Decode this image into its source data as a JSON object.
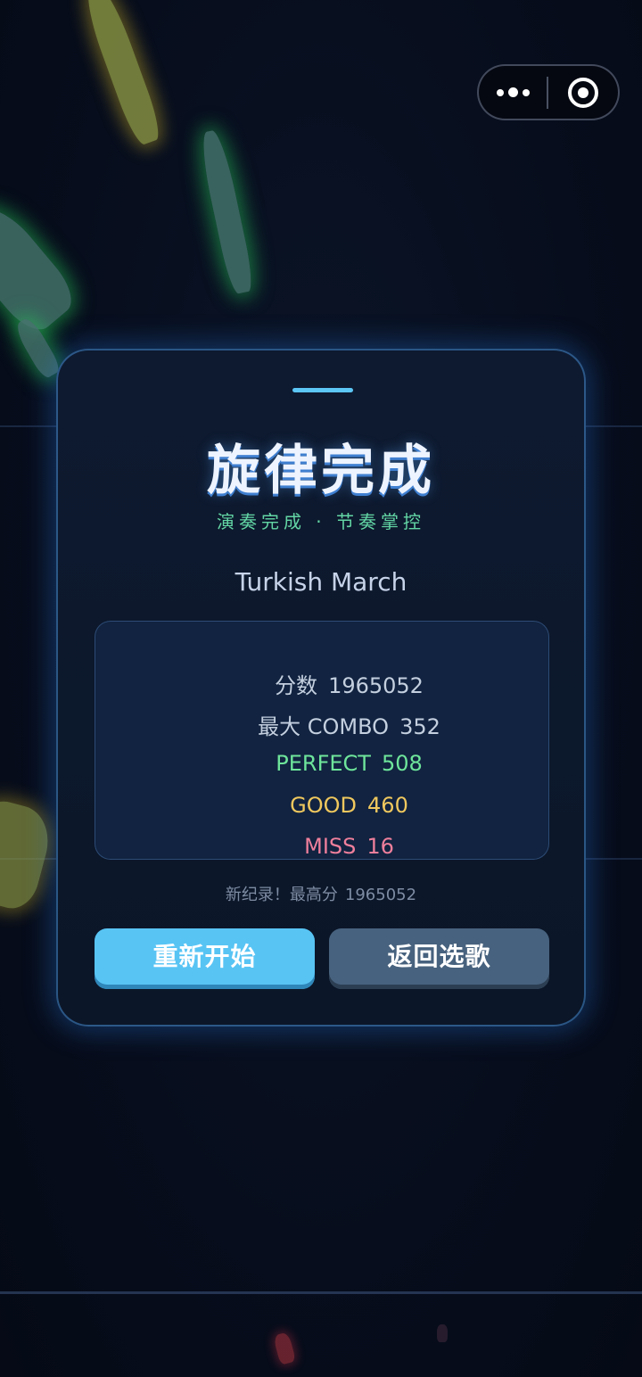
{
  "result": {
    "title": "旋律完成",
    "subtitle": "演奏完成 · 节奏掌控",
    "song_name": "Turkish March"
  },
  "stats": {
    "score_label": "分数",
    "score_value": "1965052",
    "combo_label": "最大 COMBO",
    "combo_value": "352",
    "perfect_label": "PERFECT",
    "perfect_value": "508",
    "good_label": "GOOD",
    "good_value": "460",
    "miss_label": "MISS",
    "miss_value": "16"
  },
  "record": {
    "text": "新纪录！最高分",
    "value": "1965052"
  },
  "buttons": {
    "restart_label": "重新开始",
    "back_label": "返回选歌"
  },
  "colors": {
    "accent": "#58c4f4",
    "perfect": "#6ee59b",
    "good": "#f0c85e",
    "miss": "#ef7f9c",
    "title_glow": "#3f7fd0"
  },
  "icons": {
    "menu": "more-dots-icon",
    "close": "target-close-icon"
  }
}
